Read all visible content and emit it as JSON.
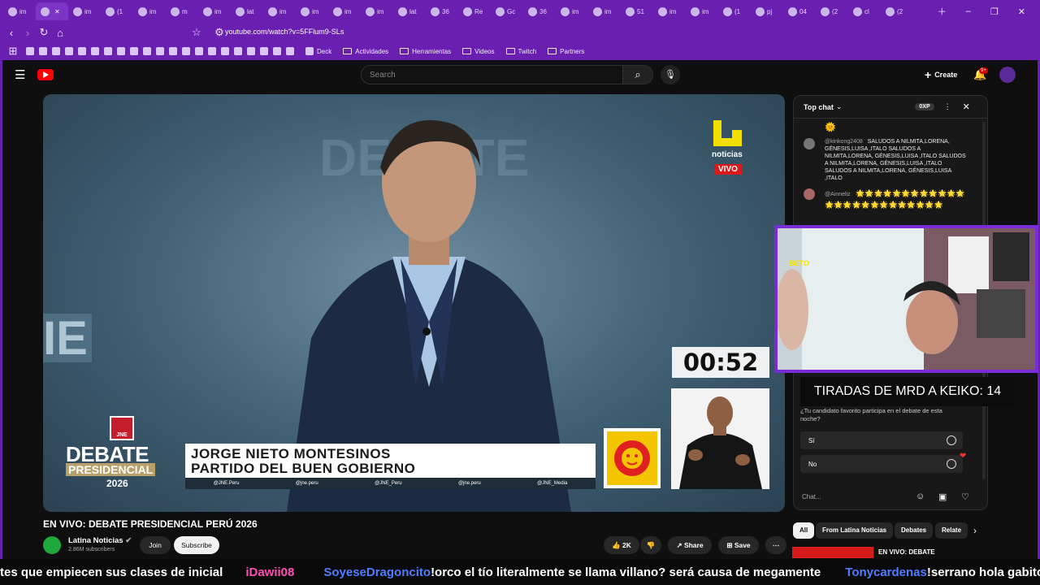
{
  "browser": {
    "tabs": [
      {
        "label": "im",
        "active": false
      },
      {
        "label": "",
        "active": true
      },
      {
        "label": "im",
        "active": false
      },
      {
        "label": "(1",
        "active": false
      },
      {
        "label": "im",
        "active": false
      },
      {
        "label": "m",
        "active": false
      },
      {
        "label": "im",
        "active": false
      },
      {
        "label": "lat",
        "active": false
      },
      {
        "label": "im",
        "active": false
      },
      {
        "label": "im",
        "active": false
      },
      {
        "label": "im",
        "active": false
      },
      {
        "label": "im",
        "active": false
      },
      {
        "label": "lat",
        "active": false
      },
      {
        "label": "36",
        "active": false
      },
      {
        "label": "Re",
        "active": false
      },
      {
        "label": "Gc",
        "active": false
      },
      {
        "label": "36",
        "active": false
      },
      {
        "label": "im",
        "active": false
      },
      {
        "label": "im",
        "active": false
      },
      {
        "label": "51",
        "active": false
      },
      {
        "label": "im",
        "active": false
      },
      {
        "label": "im",
        "active": false
      },
      {
        "label": "(1",
        "active": false
      },
      {
        "label": "pj",
        "active": false
      },
      {
        "label": "04",
        "active": false
      },
      {
        "label": "(2",
        "active": false
      },
      {
        "label": "cl",
        "active": false
      },
      {
        "label": "(2",
        "active": false
      }
    ],
    "url": "youtube.com/watch?v=5FFlum9-SLs",
    "bookmarks": [
      "Deck",
      "Actividades",
      "Herramientas",
      "Videos",
      "Twitch",
      "Partners"
    ]
  },
  "youtube": {
    "search_placeholder": "Search",
    "create_label": "Create",
    "notif_badge": "9+"
  },
  "video": {
    "timer": "00:52",
    "speaker_name": "JORGE NIETO MONTESINOS",
    "speaker_party": "PARTIDO DEL BUEN GOBIERNO",
    "socials": [
      "@JNE.Peru",
      "@jne.peru",
      "@JNE_Peru",
      "@jne.peru",
      "@JNE_Media"
    ],
    "debate_line1": "DEBATE",
    "debate_line2": "PRESIDENCIAL",
    "debate_year": "2026",
    "jne": "JNE",
    "channel_bug": "noticias",
    "vivo": "VIVO"
  },
  "chat": {
    "header": "Top chat",
    "points": "0XP",
    "messages": [
      {
        "author": "@kinkong2408",
        "text": "SALUDOS A NILMITA,LORENA, GÉNESIS,LUISA ,ITALO SALUDOS A NILMITA,LORENA, GÉNESIS,LUISA ,ITALO SALUDOS A NILMITA,LORENA, GÉNESIS,LUISA ,ITALO SALUDOS A NILMITA,LORENA, GÉNESIS,LUISA ,ITALO"
      },
      {
        "author": "@Ainneliz",
        "text": "🌟🌟🌟🌟🌟🌟🌟🌟🌟🌟🌟🌟🌟🌟🌟🌟🌟🌟🌟🌟🌟🌟🌟🌟🌟"
      }
    ],
    "poll_question": "¿Tu candidato favorito participa en el debate de esta noche?",
    "poll_options": [
      "Sí",
      "No"
    ],
    "input_placeholder": "Chat..."
  },
  "overlay": {
    "tiradas": "TIRADAS DE MRD A KEIKO: 14",
    "webcam_tag": "BETO"
  },
  "below": {
    "title": "EN VIVO: DEBATE PRESIDENCIAL PERÚ 2026",
    "channel": "Latina Noticias",
    "subs": "2.86M subscribers",
    "join": "Join",
    "subscribe": "Subscribe",
    "likes": "2K",
    "share": "Share",
    "save": "Save",
    "chips": [
      "All",
      "From Latina Noticias",
      "Debates",
      "Relate"
    ],
    "related_title": "EN VIVO: DEBATE"
  },
  "ticker": [
    {
      "user": "",
      "text": "tes que empiecen sus clases de inicial"
    },
    {
      "user": "iDawii08",
      "text": "",
      "pink": true
    },
    {
      "user": "SoyeseDragoncito",
      "text": "!orco el tío literalmente se llama villano? será causa de megamente"
    },
    {
      "user": "Tonycardenas",
      "text": "!serrano hola gabito"
    }
  ],
  "colors": {
    "browser_accent": "#6a1fb0",
    "yt_red": "#ff0000",
    "vivo_red": "#d81a1a",
    "webcam_border": "#7a2bd8"
  }
}
